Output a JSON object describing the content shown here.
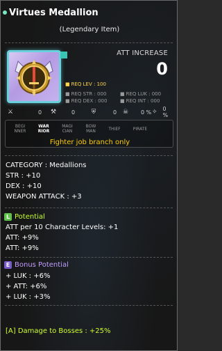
{
  "item": {
    "name": "Virtues Medallion",
    "rarity": "(Legendary Item)",
    "icon": "medallion-icon"
  },
  "att_increase": {
    "label": "ATT INCREASE",
    "value": "0"
  },
  "requirements": {
    "level": "REQ LEV : 100",
    "str": "REQ STR : 000",
    "luk": "REQ LUK : 000",
    "dex": "REQ DEX : 000",
    "int": "REQ INT : 000"
  },
  "stat_icons": [
    {
      "icon": "sword-icon",
      "value": "0"
    },
    {
      "icon": "warrior-helm-icon",
      "value": "0"
    },
    {
      "icon": "shield-icon",
      "value": "0"
    },
    {
      "icon": "boss-icon",
      "value": "0 %"
    },
    {
      "icon": "ignore-defense-icon",
      "value": "0 %"
    }
  ],
  "jobs": [
    {
      "label": "BEGI\nNNER",
      "active": false
    },
    {
      "label": "WAR\nRIOR",
      "active": true
    },
    {
      "label": "MAGI\nCIAN",
      "active": false
    },
    {
      "label": "BOW\nMAN",
      "active": false
    },
    {
      "label": "THIEF",
      "active": false
    },
    {
      "label": "PIRATE",
      "active": false
    }
  ],
  "job_note": "Fighter job branch only",
  "base_stats": [
    "CATEGORY : Medallions",
    "STR : +10",
    "DEX : +10",
    "WEAPON ATTACK : +3"
  ],
  "potential": {
    "badge": "L",
    "label": "Potential",
    "lines": [
      "ATT per 10 Character Levels: +1",
      "ATT: +9%",
      "ATT: +9%"
    ]
  },
  "bonus_potential": {
    "badge": "E",
    "label": "Bonus Potential",
    "lines": [
      "+ LUK : +6%",
      "+ ATT: +6%",
      "+ LUK : +3%"
    ]
  },
  "soul": "[A] Damage to Bosses : +25%",
  "colors": {
    "req_level": "#ffd54a",
    "job_note": "#ffcc00",
    "potential": "#c8ff2a",
    "bonus_potential": "#c29cff",
    "frame": "#6ad0dc"
  }
}
